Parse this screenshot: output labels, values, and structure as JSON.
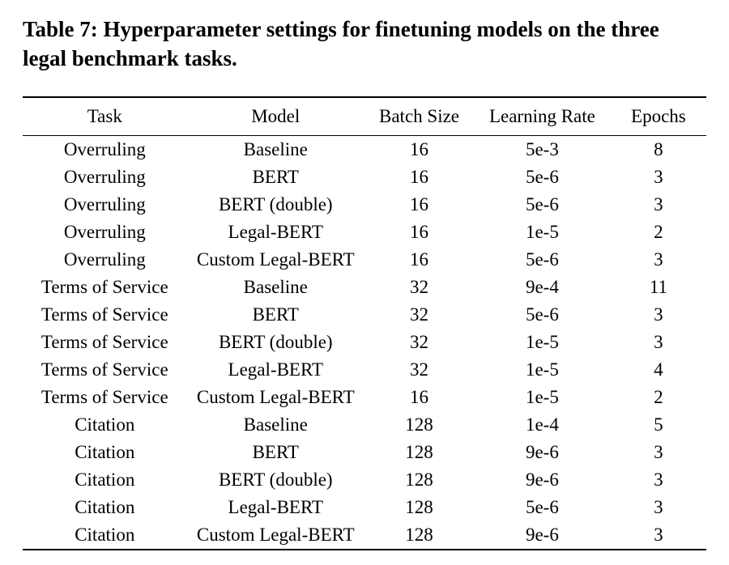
{
  "caption": "Table 7: Hyperparameter settings for finetuning models on the three legal benchmark tasks.",
  "headers": [
    "Task",
    "Model",
    "Batch Size",
    "Learning Rate",
    "Epochs"
  ],
  "chart_data": {
    "type": "table",
    "columns": [
      "Task",
      "Model",
      "Batch Size",
      "Learning Rate",
      "Epochs"
    ],
    "rows": [
      {
        "task": "Overruling",
        "model": "Baseline",
        "batch_size": "16",
        "lr": "5e-3",
        "epochs": "8"
      },
      {
        "task": "Overruling",
        "model": "BERT",
        "batch_size": "16",
        "lr": "5e-6",
        "epochs": "3"
      },
      {
        "task": "Overruling",
        "model": "BERT (double)",
        "batch_size": "16",
        "lr": "5e-6",
        "epochs": "3"
      },
      {
        "task": "Overruling",
        "model": "Legal-BERT",
        "batch_size": "16",
        "lr": "1e-5",
        "epochs": "2"
      },
      {
        "task": "Overruling",
        "model": "Custom Legal-BERT",
        "batch_size": "16",
        "lr": "5e-6",
        "epochs": "3"
      },
      {
        "task": "Terms of Service",
        "model": "Baseline",
        "batch_size": "32",
        "lr": "9e-4",
        "epochs": "11"
      },
      {
        "task": "Terms of Service",
        "model": "BERT",
        "batch_size": "32",
        "lr": "5e-6",
        "epochs": "3"
      },
      {
        "task": "Terms of Service",
        "model": "BERT (double)",
        "batch_size": "32",
        "lr": "1e-5",
        "epochs": "3"
      },
      {
        "task": "Terms of Service",
        "model": "Legal-BERT",
        "batch_size": "32",
        "lr": "1e-5",
        "epochs": "4"
      },
      {
        "task": "Terms of Service",
        "model": "Custom Legal-BERT",
        "batch_size": "16",
        "lr": "1e-5",
        "epochs": "2"
      },
      {
        "task": "Citation",
        "model": "Baseline",
        "batch_size": "128",
        "lr": "1e-4",
        "epochs": "5"
      },
      {
        "task": "Citation",
        "model": "BERT",
        "batch_size": "128",
        "lr": "9e-6",
        "epochs": "3"
      },
      {
        "task": "Citation",
        "model": "BERT (double)",
        "batch_size": "128",
        "lr": "9e-6",
        "epochs": "3"
      },
      {
        "task": "Citation",
        "model": "Legal-BERT",
        "batch_size": "128",
        "lr": "5e-6",
        "epochs": "3"
      },
      {
        "task": "Citation",
        "model": "Custom Legal-BERT",
        "batch_size": "128",
        "lr": "9e-6",
        "epochs": "3"
      }
    ]
  }
}
